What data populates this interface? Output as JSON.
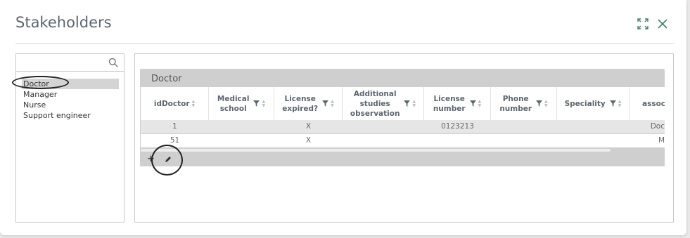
{
  "dialog": {
    "title": "Stakeholders",
    "icons": {
      "maximize": "expand-icon",
      "close": "close-icon"
    },
    "accent_color": "#3e8069"
  },
  "search": {
    "value": "",
    "placeholder": ""
  },
  "stakeholders": [
    "Doctor",
    "Manager",
    "Nurse",
    "Support engineer"
  ],
  "selected_stakeholder": "Doctor",
  "grid": {
    "title": "Doctor",
    "columns": [
      {
        "label": "idDoctor",
        "filter": false
      },
      {
        "label": "Medical\nschool",
        "filter": true
      },
      {
        "label": "License\nexpired?",
        "filter": true
      },
      {
        "label": "Additional\nstudies\nobservation",
        "filter": true
      },
      {
        "label": "License\nnumber",
        "filter": true
      },
      {
        "label": "Phone\nnumber",
        "filter": true
      },
      {
        "label": "Speciality",
        "filter": true
      },
      {
        "label": "associ",
        "filter": false
      }
    ],
    "rows": [
      [
        "1",
        "",
        "X",
        "",
        "0123213",
        "",
        "",
        "Doc"
      ],
      [
        "51",
        "",
        "X",
        "",
        "",
        "",
        "",
        "M"
      ]
    ],
    "footer": {
      "add_label": "+",
      "edit_icon": "pencil-icon"
    }
  }
}
